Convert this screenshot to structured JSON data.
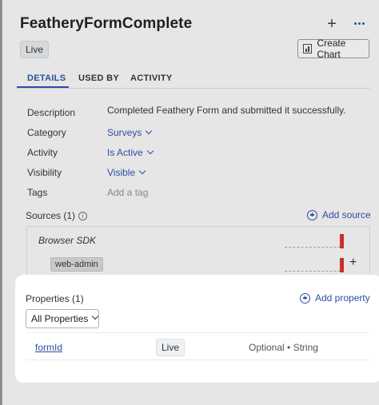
{
  "header": {
    "title": "FeatheryFormComplete",
    "status_badge": "Live",
    "create_chart_label": "Create Chart"
  },
  "tabs": [
    {
      "label": "DETAILS",
      "active": true
    },
    {
      "label": "USED BY",
      "active": false
    },
    {
      "label": "ACTIVITY",
      "active": false
    }
  ],
  "details": {
    "description_label": "Description",
    "description_value": "Completed Feathery Form and submitted it successfully.",
    "category_label": "Category",
    "category_value": "Surveys",
    "activity_label": "Activity",
    "activity_value": "Is Active",
    "visibility_label": "Visibility",
    "visibility_value": "Visible",
    "tags_label": "Tags",
    "tags_placeholder": "Add a tag"
  },
  "sources": {
    "label": "Sources (1)",
    "add_label": "Add source",
    "items": [
      {
        "name": "Browser SDK",
        "tag": "web-admin"
      }
    ]
  },
  "properties": {
    "label": "Properties (1)",
    "add_label": "Add property",
    "filter_value": "All Properties",
    "rows": [
      {
        "name": "formId",
        "status": "Live",
        "type": "Optional • String"
      }
    ]
  },
  "colors": {
    "accent": "#2d4fa0",
    "live_bar": "#c9302c"
  }
}
